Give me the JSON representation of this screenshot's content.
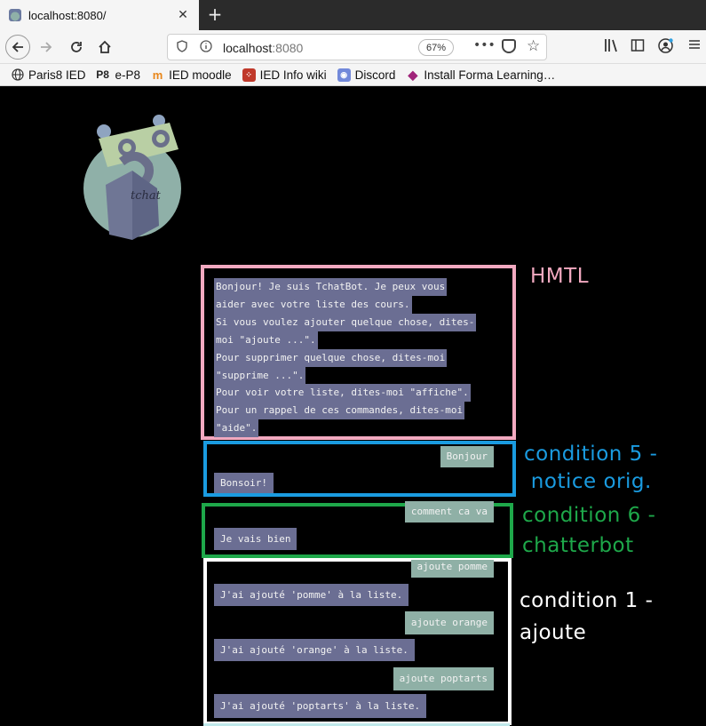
{
  "browser": {
    "tab_title": "localhost:8080/",
    "tab_close": "✕",
    "new_tab": "+",
    "url_host": "localhost",
    "url_port": ":8080",
    "zoom": "67%",
    "more": "•••"
  },
  "bookmarks": [
    {
      "label": "Paris8 IED",
      "icon": "globe-icon"
    },
    {
      "label": "e-P8",
      "icon": "p8-icon"
    },
    {
      "label": "IED moodle",
      "icon": "moodle-icon"
    },
    {
      "label": "IED Info wiki",
      "icon": "wiki-icon"
    },
    {
      "label": "Discord",
      "icon": "discord-icon"
    },
    {
      "label": "Install Forma Learning…",
      "icon": "forma-icon"
    }
  ],
  "logo": {
    "text": "tchat"
  },
  "chat": {
    "intro_lines": [
      " Bonjour! Je suis TchatBot. Je peux vous",
      "aider avec votre liste des cours.",
      "Si vous voulez ajouter quelque chose, dites-",
      "moi \"ajoute ...\".",
      "Pour supprimer quelque chose, dites-moi",
      "\"supprime ...\".",
      "Pour voir votre liste, dites-moi \"affiche\".",
      "Pour un rappel de ces commandes, dites-moi",
      "\"aide\". "
    ],
    "msg_bonjour_user": "Bonjour",
    "msg_bonjour_bot": "Bonsoir!",
    "msg_comment_user": "comment ca va",
    "msg_comment_bot": "Je vais bien",
    "msg_pomme_user": "ajoute pomme",
    "msg_pomme_bot": "J'ai ajouté 'pomme' à la liste.",
    "msg_orange_user": "ajoute orange",
    "msg_orange_bot": "J'ai ajouté 'orange' à la liste.",
    "msg_poptarts_user": "ajoute poptarts",
    "msg_poptarts_bot": "J'ai ajouté 'poptarts' à la liste."
  },
  "annotations": {
    "html": "HMTL",
    "cond5_line1": "condition 5 -",
    "cond5_line2": " notice orig.",
    "cond6_line1": "condition 6 -",
    "cond6_line2": "chatterbot",
    "cond1_line1": "condition 1 -",
    "cond1_line2": "ajoute"
  },
  "colors": {
    "bot_bubble": "#6b6e93",
    "user_bubble": "#8fb0a6",
    "html_frame": "#f2a9c0",
    "cond5_frame": "#1a9be0",
    "cond6_frame": "#1ea84a",
    "cond1_frame": "#ffffff"
  }
}
